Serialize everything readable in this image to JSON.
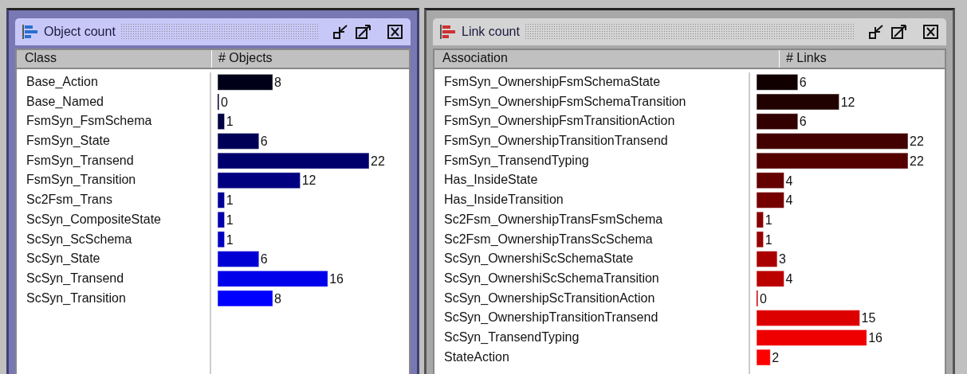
{
  "windows": [
    {
      "kind": "objects",
      "title": "Object count",
      "columns": [
        "Class",
        "# Objects"
      ],
      "chart_data": {
        "type": "bar",
        "orientation": "horizontal",
        "data_labels": true,
        "categories": [
          "Base_Action",
          "Base_Named",
          "FsmSyn_FsmSchema",
          "FsmSyn_State",
          "FsmSyn_Transend",
          "FsmSyn_Transition",
          "Sc2Fsm_Trans",
          "ScSyn_CompositeState",
          "ScSyn_ScSchema",
          "ScSyn_State",
          "ScSyn_Transend",
          "ScSyn_Transition"
        ],
        "values": [
          8,
          0,
          1,
          6,
          22,
          12,
          1,
          1,
          1,
          6,
          16,
          8
        ]
      }
    },
    {
      "kind": "links",
      "title": "Link count",
      "columns": [
        "Association",
        "# Links"
      ],
      "chart_data": {
        "type": "bar",
        "orientation": "horizontal",
        "data_labels": true,
        "categories": [
          "FsmSyn_OwnershipFsmSchemaState",
          "FsmSyn_OwnershipFsmSchemaTransition",
          "FsmSyn_OwnershipFsmTransitionAction",
          "FsmSyn_OwnershipTransitionTransend",
          "FsmSyn_TransendTyping",
          "Has_InsideState",
          "Has_InsideTransition",
          "Sc2Fsm_OwnershipTransFsmSchema",
          "Sc2Fsm_OwnershipTransScSchema",
          "ScSyn_OwnershiScSchemaState",
          "ScSyn_OwnershiScSchemaTransition",
          "ScSyn_OwnershipScTransitionAction",
          "ScSyn_OwnershipTransitionTransend",
          "ScSyn_TransendTyping",
          "StateAction"
        ],
        "values": [
          6,
          12,
          6,
          22,
          22,
          4,
          4,
          1,
          1,
          3,
          4,
          0,
          15,
          16,
          2
        ]
      }
    }
  ]
}
